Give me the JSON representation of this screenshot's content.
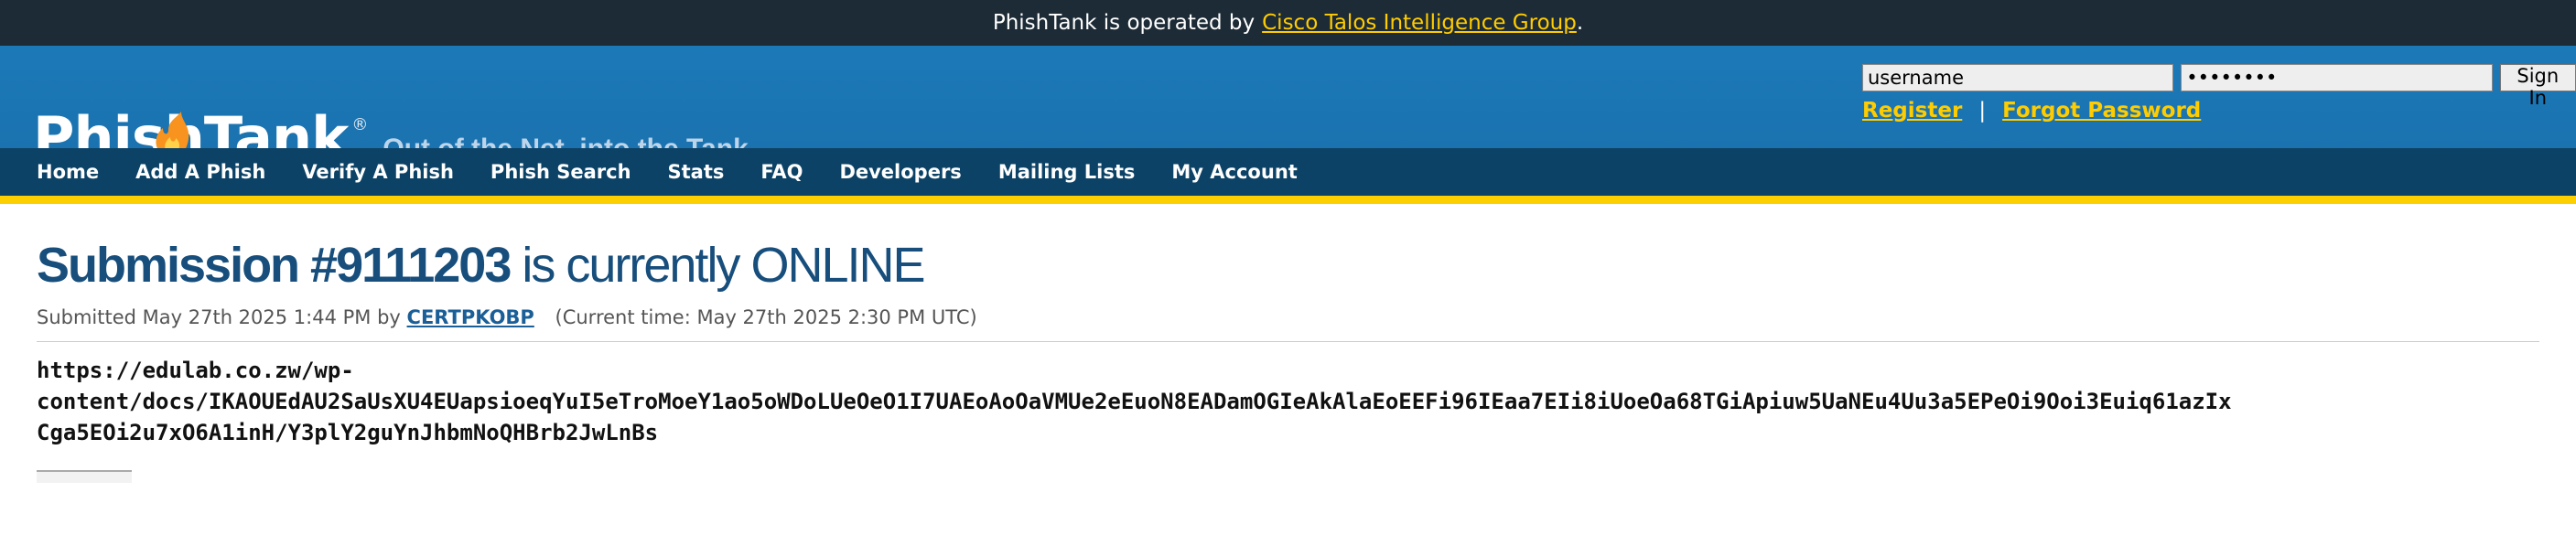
{
  "topbar": {
    "text": "PhishTank is operated by",
    "link": "Cisco Talos Intelligence Group",
    "suffix": "."
  },
  "header": {
    "logo": "PhishTank",
    "logo_reg": "®",
    "tagline": "Out of the Net, into the Tank."
  },
  "login": {
    "username_value": "username",
    "password_value": "••••••••",
    "sign_in": "Sign In",
    "register": "Register",
    "sep": "|",
    "forgot": "Forgot Password"
  },
  "nav": {
    "items": [
      "Home",
      "Add A Phish",
      "Verify A Phish",
      "Phish Search",
      "Stats",
      "FAQ",
      "Developers",
      "Mailing Lists",
      "My Account"
    ]
  },
  "submission": {
    "title_num": "Submission #9111203",
    "title_status": "is currently ONLINE",
    "submitted_prefix": "Submitted May 27th 2025 1:44 PM by",
    "submitter": "CERTPKOBP",
    "current_time": "(Current time: May 27th 2025 2:30 PM UTC)",
    "url_line1": "https://edulab.co.zw/wp-",
    "url_line2": "content/docs/IKAOUEdAU2SaUsXU4EUapsioeqYuI5eTroMoeY1ao5oWDoLUeOeO1I7UAEoAoOaVMUe2eEuoN8EADamOGIeAkAlaEoEEFi96IEaa7EIi8iUoeOa68TGiApiuw5UaNEu4Uu3a5EPeOi9Ooi3Euiq61azIx",
    "url_line3": "Cga5EOi2u7xO6A1inH/Y3plY2guYnJhbmNoQHBrb2JwLnBs"
  },
  "colors": {
    "topbar": "#1d2b36",
    "header": "#1a6fab",
    "nav": "#0c4266",
    "accent": "#fcd000",
    "title": "#174e7c"
  }
}
